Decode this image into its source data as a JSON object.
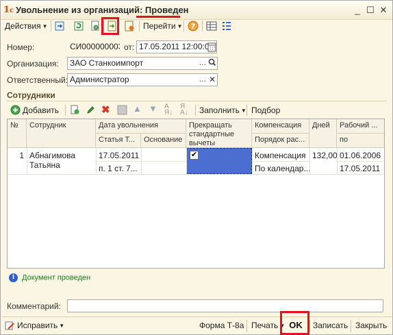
{
  "window": {
    "title": "Увольнение из организаций: Проведен",
    "logo": "1c-logo-icon"
  },
  "toolbar": {
    "actions": "Действия",
    "goto": "Перейти",
    "help": "?"
  },
  "form": {
    "number_label": "Номер:",
    "number_value": "СИ000000003",
    "date_label": "от:",
    "date_value": "17.05.2011 12:00:00",
    "org_label": "Организация:",
    "org_value": "ЗАО Станкоимпорт",
    "resp_label": "Ответственный:",
    "resp_value": "Администратор"
  },
  "employees": {
    "section_title": "Сотрудники",
    "add_label": "Добавить",
    "fill_label": "Заполнить",
    "select_label": "Подбор",
    "columns": {
      "num": "№",
      "employee": "Сотрудник",
      "dismissal_date": "Дата увольнения",
      "article": "Статья Т...",
      "basis": "Основание",
      "stop_std": "Прекращать стандартные вычеты",
      "compensation": "Компенсация",
      "comp_order": "Порядок рас...",
      "days": "Дней",
      "period": "Рабочий ...",
      "period_to": "по"
    },
    "rows": [
      {
        "num": "1",
        "employee": "Абнагимова Татьяна",
        "dismissal_date": "17.05.2011",
        "article": "п. 1 ст. 7...",
        "basis": "",
        "stop_std": true,
        "compensation": "Компенсация",
        "comp_order": "По календар...",
        "days": "132,00",
        "period_from": "01.06.2006",
        "period_to": "17.05.2011"
      }
    ]
  },
  "status": {
    "text": "Документ проведен"
  },
  "comment": {
    "label": "Комментарий:",
    "value": ""
  },
  "bottom": {
    "fix": "Исправить",
    "form_t8a": "Форма Т-8а",
    "print": "Печать",
    "ok": "OK",
    "save": "Записать",
    "close": "Закрыть"
  },
  "colors": {
    "window_bg": "#fbf6e4",
    "highlight_red": "#e0141e",
    "selected_cell": "#4c6ed0",
    "status_green": "#1f7a1f"
  }
}
